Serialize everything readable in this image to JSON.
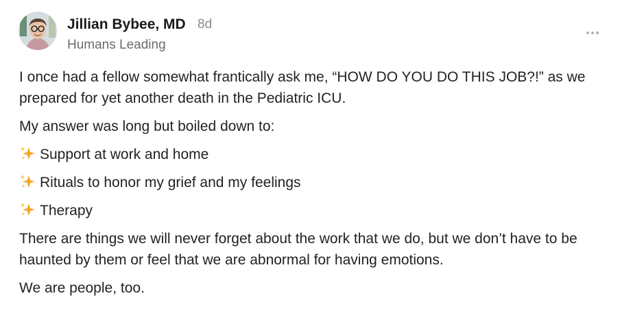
{
  "author": {
    "name": "Jillian Bybee, MD",
    "time_ago": "8d",
    "publication": "Humans Leading"
  },
  "menu": {
    "icon": "more-horizontal-icon"
  },
  "post": {
    "paragraph1": "I once had a fellow somewhat frantically ask me, “HOW DO YOU DO THIS JOB?!” as we prepared for yet another death in the Pediatric ICU.",
    "paragraph2": "My answer was long but boiled down to:",
    "list": [
      {
        "icon": "sparkles-icon",
        "text": "Support at work and home"
      },
      {
        "icon": "sparkles-icon",
        "text": "Rituals to honor my grief and my feelings"
      },
      {
        "icon": "sparkles-icon",
        "text": "Therapy"
      }
    ],
    "paragraph3": "There are things we will never forget about the work that we do, but we don’t have to be haunted by them or feel that we are abnormal for having emotions.",
    "paragraph4": "We are people, too."
  },
  "colors": {
    "name": "#1a1a1a",
    "meta": "#8a8a8a",
    "body": "#222222",
    "sparkle": "#f5a623"
  }
}
